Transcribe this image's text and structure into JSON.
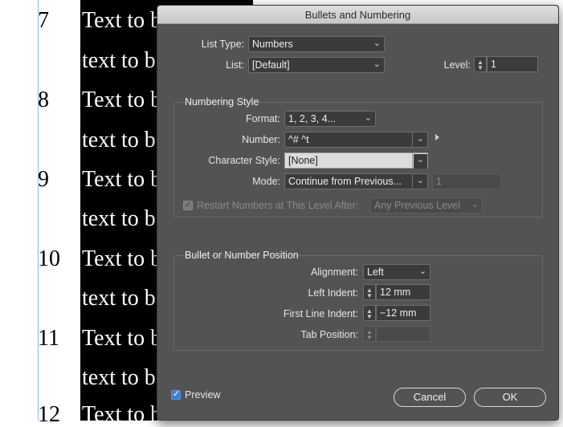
{
  "document": {
    "numbers": [
      "7",
      "8",
      "9",
      "10",
      "11",
      "12"
    ],
    "line_a": "Text to b",
    "line_b": "text to b"
  },
  "dialog": {
    "title": "Bullets and Numbering",
    "list_type": {
      "label": "List Type:",
      "value": "Numbers"
    },
    "list": {
      "label": "List:",
      "value": "[Default]"
    },
    "level": {
      "label": "Level:",
      "value": "1"
    },
    "numbering_style": {
      "title": "Numbering Style",
      "format": {
        "label": "Format:",
        "value": "1, 2, 3, 4..."
      },
      "number": {
        "label": "Number:",
        "value": "^# ^t"
      },
      "character_style": {
        "label": "Character Style:",
        "value": "[None]"
      },
      "mode": {
        "label": "Mode:",
        "value": "Continue from Previous...",
        "start": "1"
      },
      "restart": {
        "label": "Restart Numbers at This Level After:",
        "value": "Any Previous Level",
        "checked": true
      }
    },
    "position": {
      "title": "Bullet or Number Position",
      "alignment": {
        "label": "Alignment:",
        "value": "Left"
      },
      "left_indent": {
        "label": "Left Indent:",
        "value": "12 mm"
      },
      "first_line_indent": {
        "label": "First Line Indent:",
        "value": "−12 mm"
      },
      "tab_position": {
        "label": "Tab Position:",
        "value": ""
      }
    },
    "preview": {
      "label": "Preview",
      "checked": true
    },
    "cancel_label": "Cancel",
    "ok_label": "OK"
  },
  "colors": {
    "dialog_bg": "#535353",
    "field_bg": "#3b3b3b",
    "checkbox_accent": "#3d7fd6"
  }
}
